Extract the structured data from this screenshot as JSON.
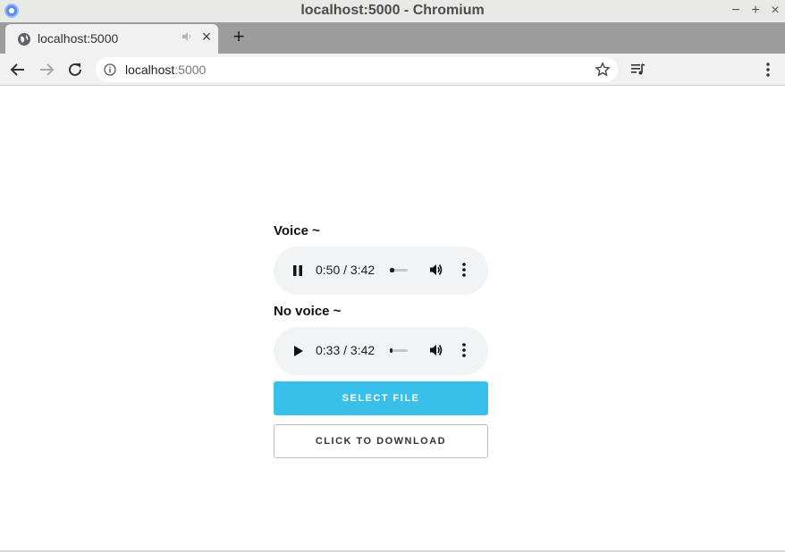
{
  "window": {
    "title": "localhost:5000 - Chromium",
    "minimize": "−",
    "maximize": "+",
    "close": "×"
  },
  "tabs": [
    {
      "title": "localhost:5000",
      "close": "×"
    }
  ],
  "new_tab": "+",
  "omnibox": {
    "host": "localhost",
    "port": ":5000"
  },
  "page": {
    "voice_label": "Voice ~",
    "novoice_label": "No voice ~",
    "players": [
      {
        "state": "playing",
        "current": "0:50",
        "duration": "3:42",
        "time_text": "0:50 / 3:42",
        "progress": 0.225
      },
      {
        "state": "paused",
        "current": "0:33",
        "duration": "3:42",
        "time_text": "0:33 / 3:42",
        "progress": 0.149
      }
    ],
    "select_file_label": "SELECT FILE",
    "download_label": "CLICK TO DOWNLOAD"
  },
  "colors": {
    "accent": "#39c0ea",
    "player_bg": "#f1f3f4",
    "tabstrip": "#9c9c9c"
  },
  "icons": [
    "chromium-icon",
    "globe-icon",
    "mute-icon",
    "back-icon",
    "forward-icon",
    "reload-icon",
    "info-icon",
    "star-icon",
    "media-control-icon",
    "kebab-menu-icon",
    "pause-icon",
    "play-icon",
    "volume-icon"
  ]
}
